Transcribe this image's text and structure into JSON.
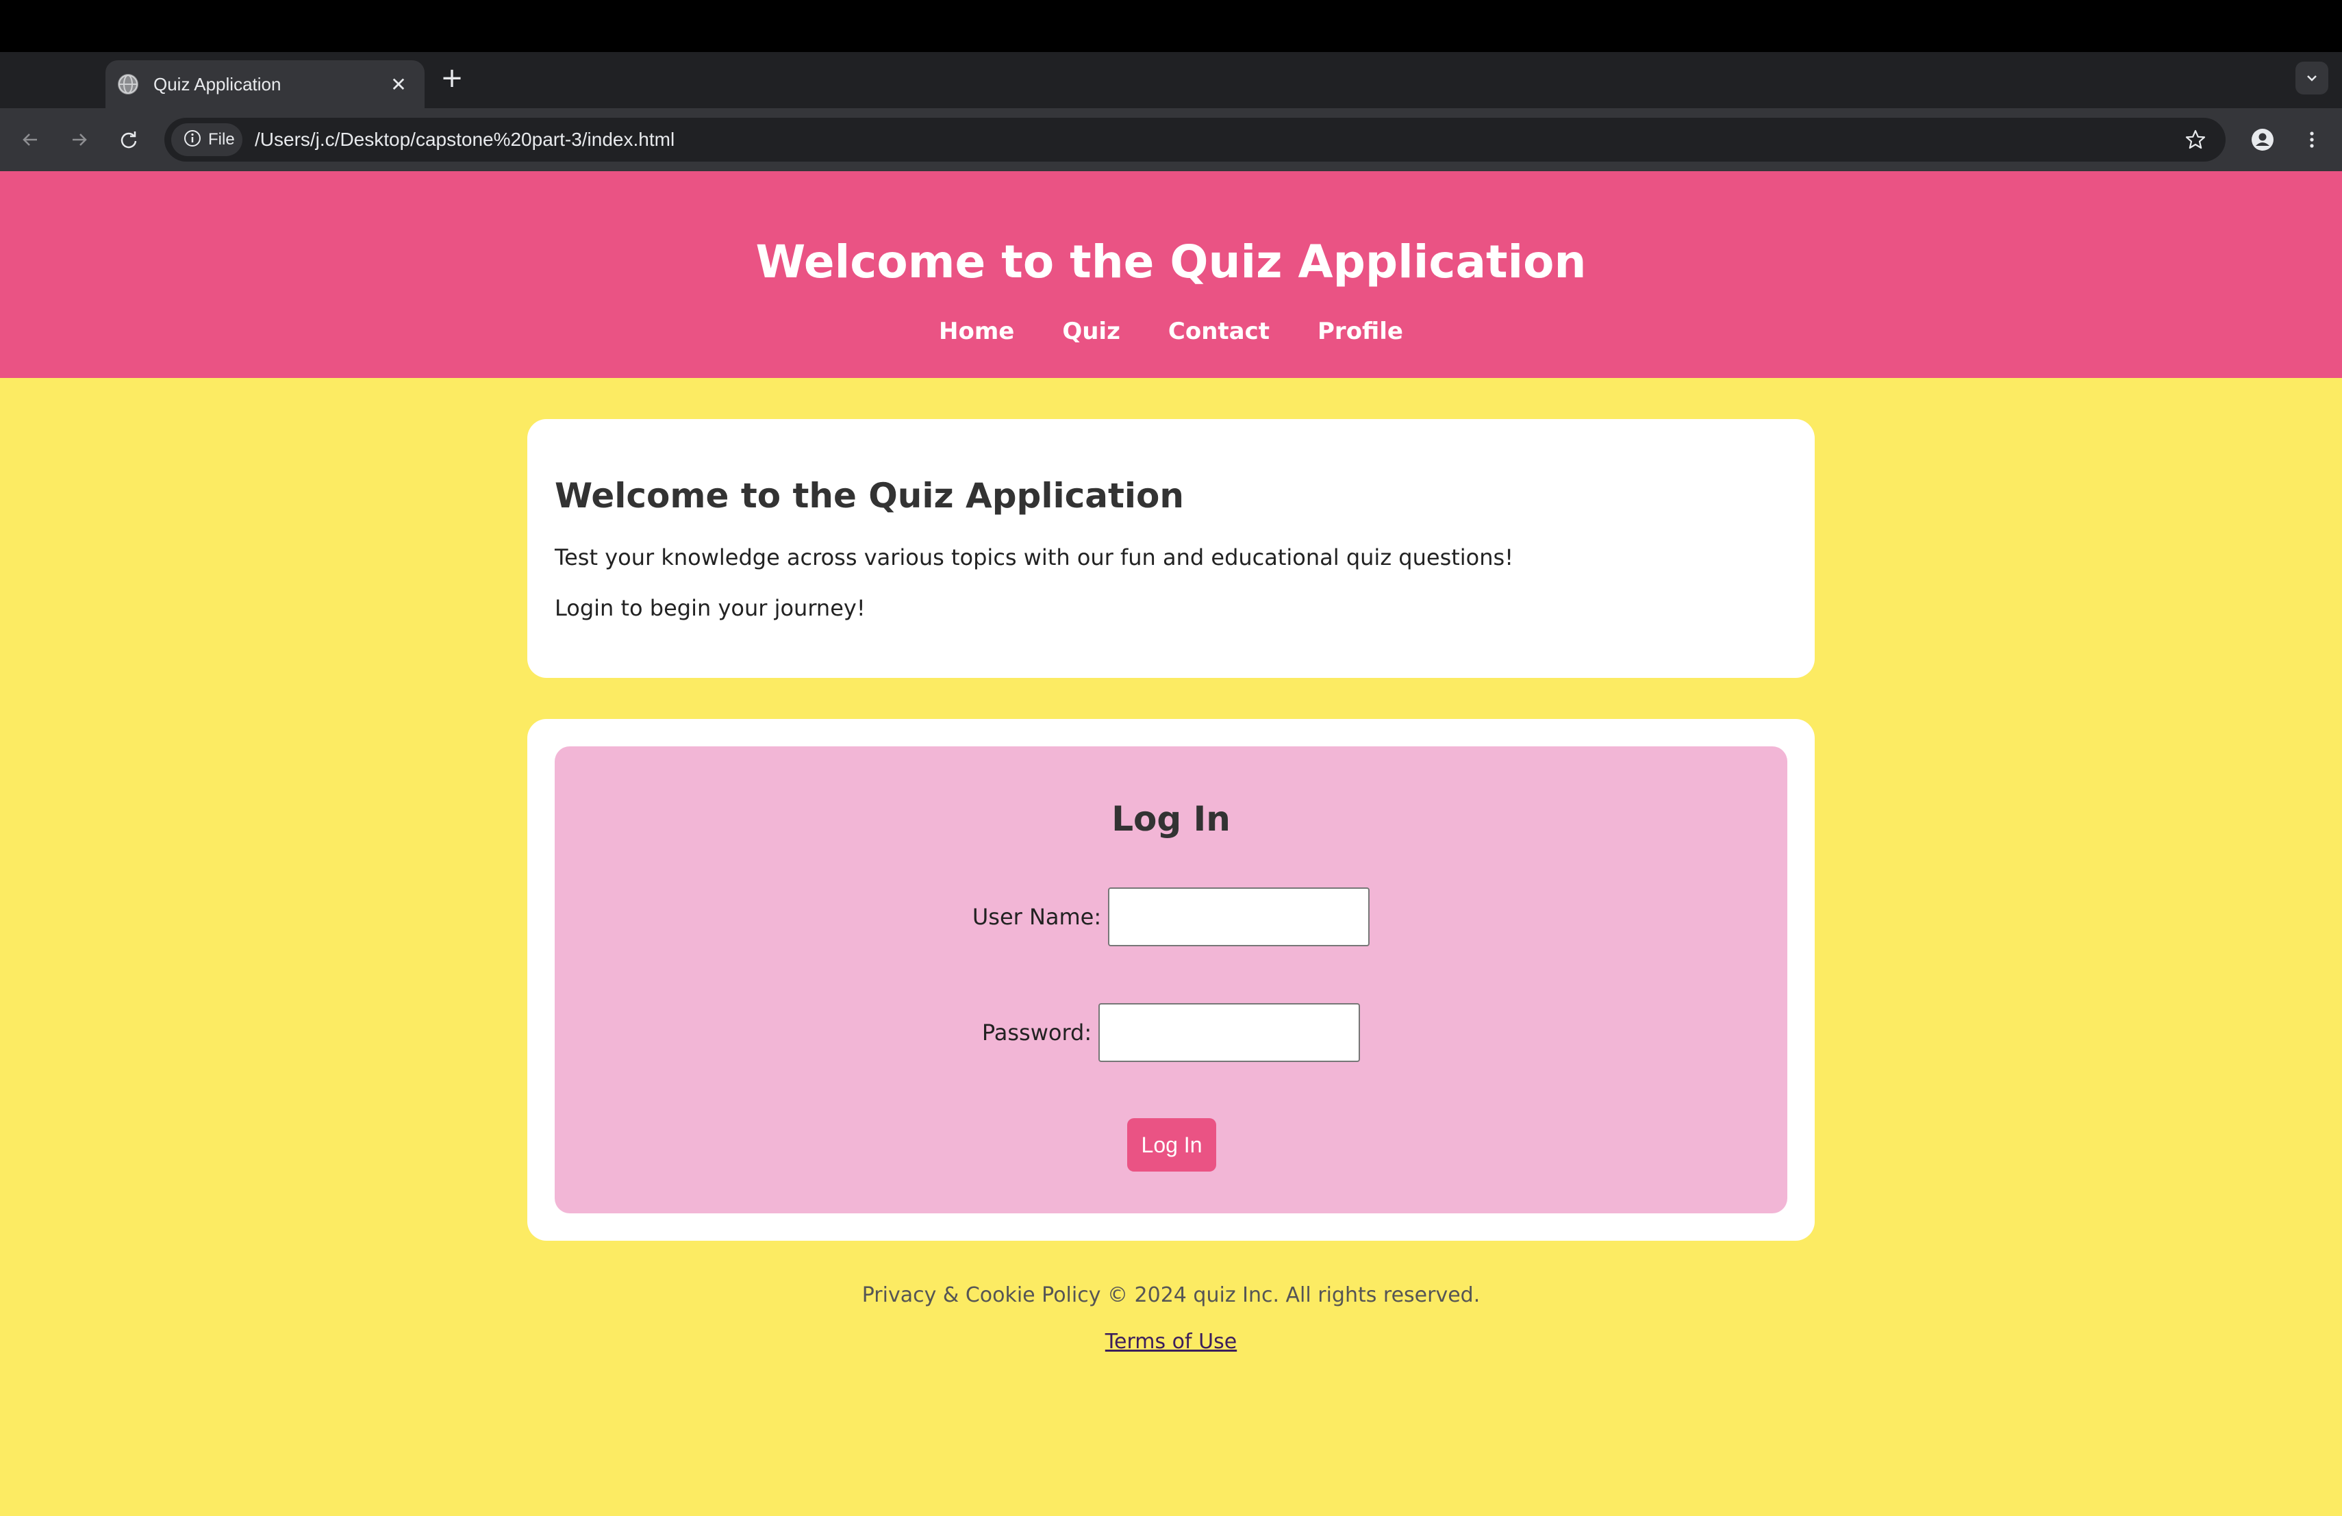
{
  "browser": {
    "tab_title": "Quiz Application",
    "new_tab_symbol": "+",
    "close_symbol": "✕",
    "file_chip_label": "File",
    "url": "/Users/j.c/Desktop/capstone%20part-3/index.html",
    "icons": [
      "globe-icon",
      "close-icon",
      "plus-icon",
      "chevron-down-icon",
      "back-icon",
      "forward-icon",
      "reload-icon",
      "info-icon",
      "star-icon",
      "profile-icon",
      "more-vert-icon"
    ]
  },
  "header": {
    "title": "Welcome to the Quiz Application",
    "nav": [
      "Home",
      "Quiz",
      "Contact",
      "Profile"
    ]
  },
  "welcome": {
    "heading": "Welcome to the Quiz Application",
    "text": "Test your knowledge across various topics with our fun and educational quiz questions!",
    "cta": "Login to begin your journey!"
  },
  "login": {
    "heading": "Log In",
    "username_label": "User Name:",
    "password_label": "Password:",
    "button_label": "Log In"
  },
  "footer": {
    "text": "Privacy & Cookie Policy © 2024 quiz Inc. All rights reserved.",
    "link": "Terms of Use"
  },
  "colors": {
    "header_bg": "#ea5384",
    "page_bg": "#fceb63",
    "login_panel_bg": "#f2b6d6",
    "button_bg": "#ea5384"
  }
}
